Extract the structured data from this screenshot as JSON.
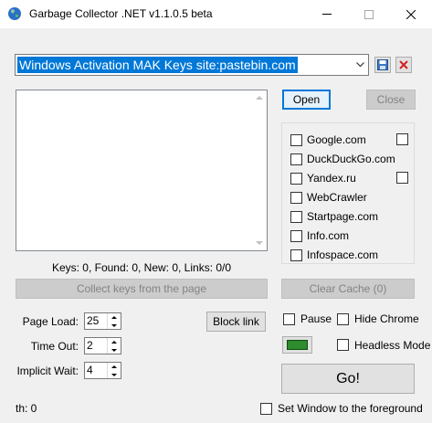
{
  "window": {
    "title": "Garbage Collector .NET v1.1.0.5 beta"
  },
  "search": {
    "query": "Windows Activation MAK Keys site:pastebin.com"
  },
  "stats": {
    "text": "Keys: 0, Found: 0, New: 0, Links: 0/0"
  },
  "buttons": {
    "open": "Open",
    "close": "Close",
    "collect": "Collect keys from the page",
    "clear_cache": "Clear Cache (0)",
    "block_link": "Block link",
    "go": "Go!"
  },
  "engines": [
    {
      "label": "Google.com",
      "checked": false,
      "extra": true
    },
    {
      "label": "DuckDuckGo.com",
      "checked": false,
      "extra": false
    },
    {
      "label": "Yandex.ru",
      "checked": false,
      "extra": true
    },
    {
      "label": "WebCrawler",
      "checked": false,
      "extra": false
    },
    {
      "label": "Startpage.com",
      "checked": false,
      "extra": false
    },
    {
      "label": "Info.com",
      "checked": false,
      "extra": false
    },
    {
      "label": "Infospace.com",
      "checked": false,
      "extra": false
    }
  ],
  "settings": {
    "page_load_label": "Page Load:",
    "page_load_value": "25",
    "time_out_label": "Time Out:",
    "time_out_value": "2",
    "implicit_wait_label": "Implicit Wait:",
    "implicit_wait_value": "4"
  },
  "options": {
    "pause": "Pause",
    "hide_chrome": "Hide Chrome",
    "headless": "Headless Mode",
    "foreground": "Set Window to the foreground"
  },
  "status": {
    "threads": "th: 0"
  },
  "colors": {
    "selection": "#0078d7",
    "swatch": "#2e8b2e"
  }
}
